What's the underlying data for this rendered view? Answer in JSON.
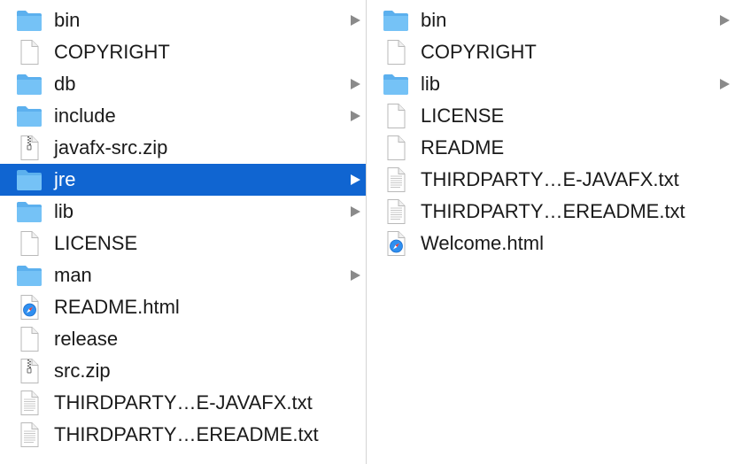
{
  "icons": {
    "folder": "folder-icon",
    "document": "document-icon",
    "text_document": "text-document-icon",
    "zip": "zip-archive-icon",
    "html": "safari-html-icon"
  },
  "colors": {
    "selection": "#1065d1",
    "folder": "#69b9f0",
    "chevron": "#8a8a8a"
  },
  "columns": [
    {
      "name": "jdk-contents",
      "selected_index": 5,
      "items": [
        {
          "label": "bin",
          "type": "folder",
          "has_children": true
        },
        {
          "label": "COPYRIGHT",
          "type": "document",
          "has_children": false
        },
        {
          "label": "db",
          "type": "folder",
          "has_children": true
        },
        {
          "label": "include",
          "type": "folder",
          "has_children": true
        },
        {
          "label": "javafx-src.zip",
          "type": "zip",
          "has_children": false
        },
        {
          "label": "jre",
          "type": "folder",
          "has_children": true
        },
        {
          "label": "lib",
          "type": "folder",
          "has_children": true
        },
        {
          "label": "LICENSE",
          "type": "document",
          "has_children": false
        },
        {
          "label": "man",
          "type": "folder",
          "has_children": true
        },
        {
          "label": "README.html",
          "type": "html",
          "has_children": false
        },
        {
          "label": "release",
          "type": "document",
          "has_children": false
        },
        {
          "label": "src.zip",
          "type": "zip",
          "has_children": false
        },
        {
          "label": "THIRDPARTY…E-JAVAFX.txt",
          "type": "text_document",
          "has_children": false
        },
        {
          "label": "THIRDPARTY…EREADME.txt",
          "type": "text_document",
          "has_children": false
        }
      ]
    },
    {
      "name": "jre-contents",
      "selected_index": null,
      "items": [
        {
          "label": "bin",
          "type": "folder",
          "has_children": true
        },
        {
          "label": "COPYRIGHT",
          "type": "document",
          "has_children": false
        },
        {
          "label": "lib",
          "type": "folder",
          "has_children": true
        },
        {
          "label": "LICENSE",
          "type": "document",
          "has_children": false
        },
        {
          "label": "README",
          "type": "document",
          "has_children": false
        },
        {
          "label": "THIRDPARTY…E-JAVAFX.txt",
          "type": "text_document",
          "has_children": false
        },
        {
          "label": "THIRDPARTY…EREADME.txt",
          "type": "text_document",
          "has_children": false
        },
        {
          "label": "Welcome.html",
          "type": "html",
          "has_children": false
        }
      ]
    }
  ]
}
